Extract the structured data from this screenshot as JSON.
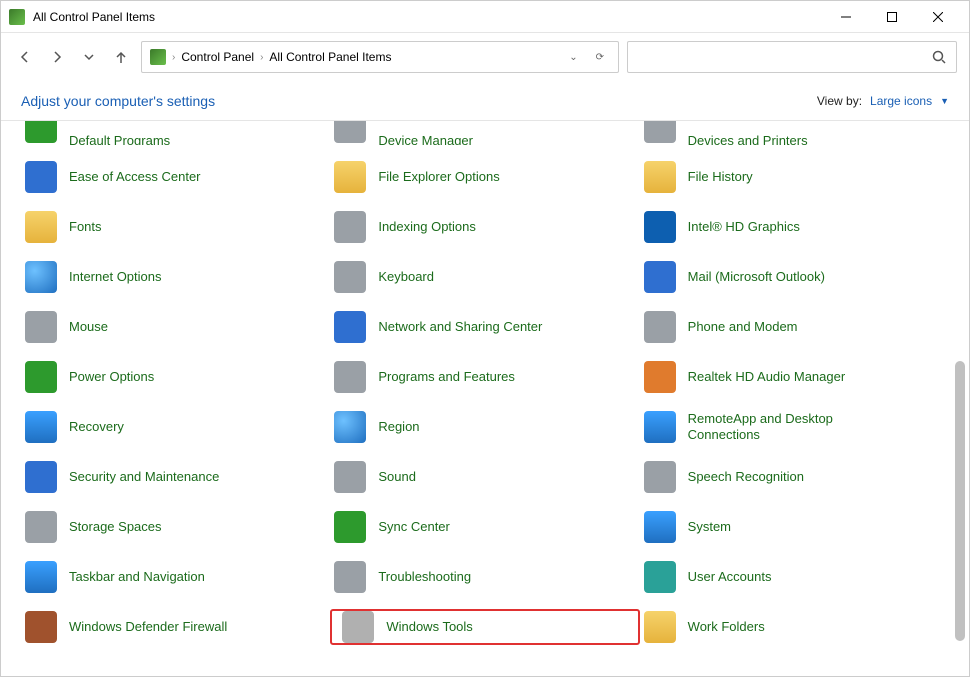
{
  "window": {
    "title": "All Control Panel Items"
  },
  "breadcrumb": {
    "root": "Control Panel",
    "current": "All Control Panel Items"
  },
  "header": {
    "adjust": "Adjust your computer's settings",
    "viewby_label": "View by:",
    "viewby_value": "Large icons"
  },
  "cutoff": {
    "c0": "Default Programs",
    "c1": "Device Manager",
    "c2": "Devices and Printers"
  },
  "items": {
    "r0": {
      "c0": "Ease of Access Center",
      "c1": "File Explorer Options",
      "c2": "File History"
    },
    "r1": {
      "c0": "Fonts",
      "c1": "Indexing Options",
      "c2": "Intel® HD Graphics"
    },
    "r2": {
      "c0": "Internet Options",
      "c1": "Keyboard",
      "c2": "Mail (Microsoft Outlook)"
    },
    "r3": {
      "c0": "Mouse",
      "c1": "Network and Sharing Center",
      "c2": "Phone and Modem"
    },
    "r4": {
      "c0": "Power Options",
      "c1": "Programs and Features",
      "c2": "Realtek HD Audio Manager"
    },
    "r5": {
      "c0": "Recovery",
      "c1": "Region",
      "c2": "RemoteApp and Desktop Connections"
    },
    "r6": {
      "c0": "Security and Maintenance",
      "c1": "Sound",
      "c2": "Speech Recognition"
    },
    "r7": {
      "c0": "Storage Spaces",
      "c1": "Sync Center",
      "c2": "System"
    },
    "r8": {
      "c0": "Taskbar and Navigation",
      "c1": "Troubleshooting",
      "c2": "User Accounts"
    },
    "r9": {
      "c0": "Windows Defender Firewall",
      "c1": "Windows Tools",
      "c2": "Work Folders"
    }
  }
}
